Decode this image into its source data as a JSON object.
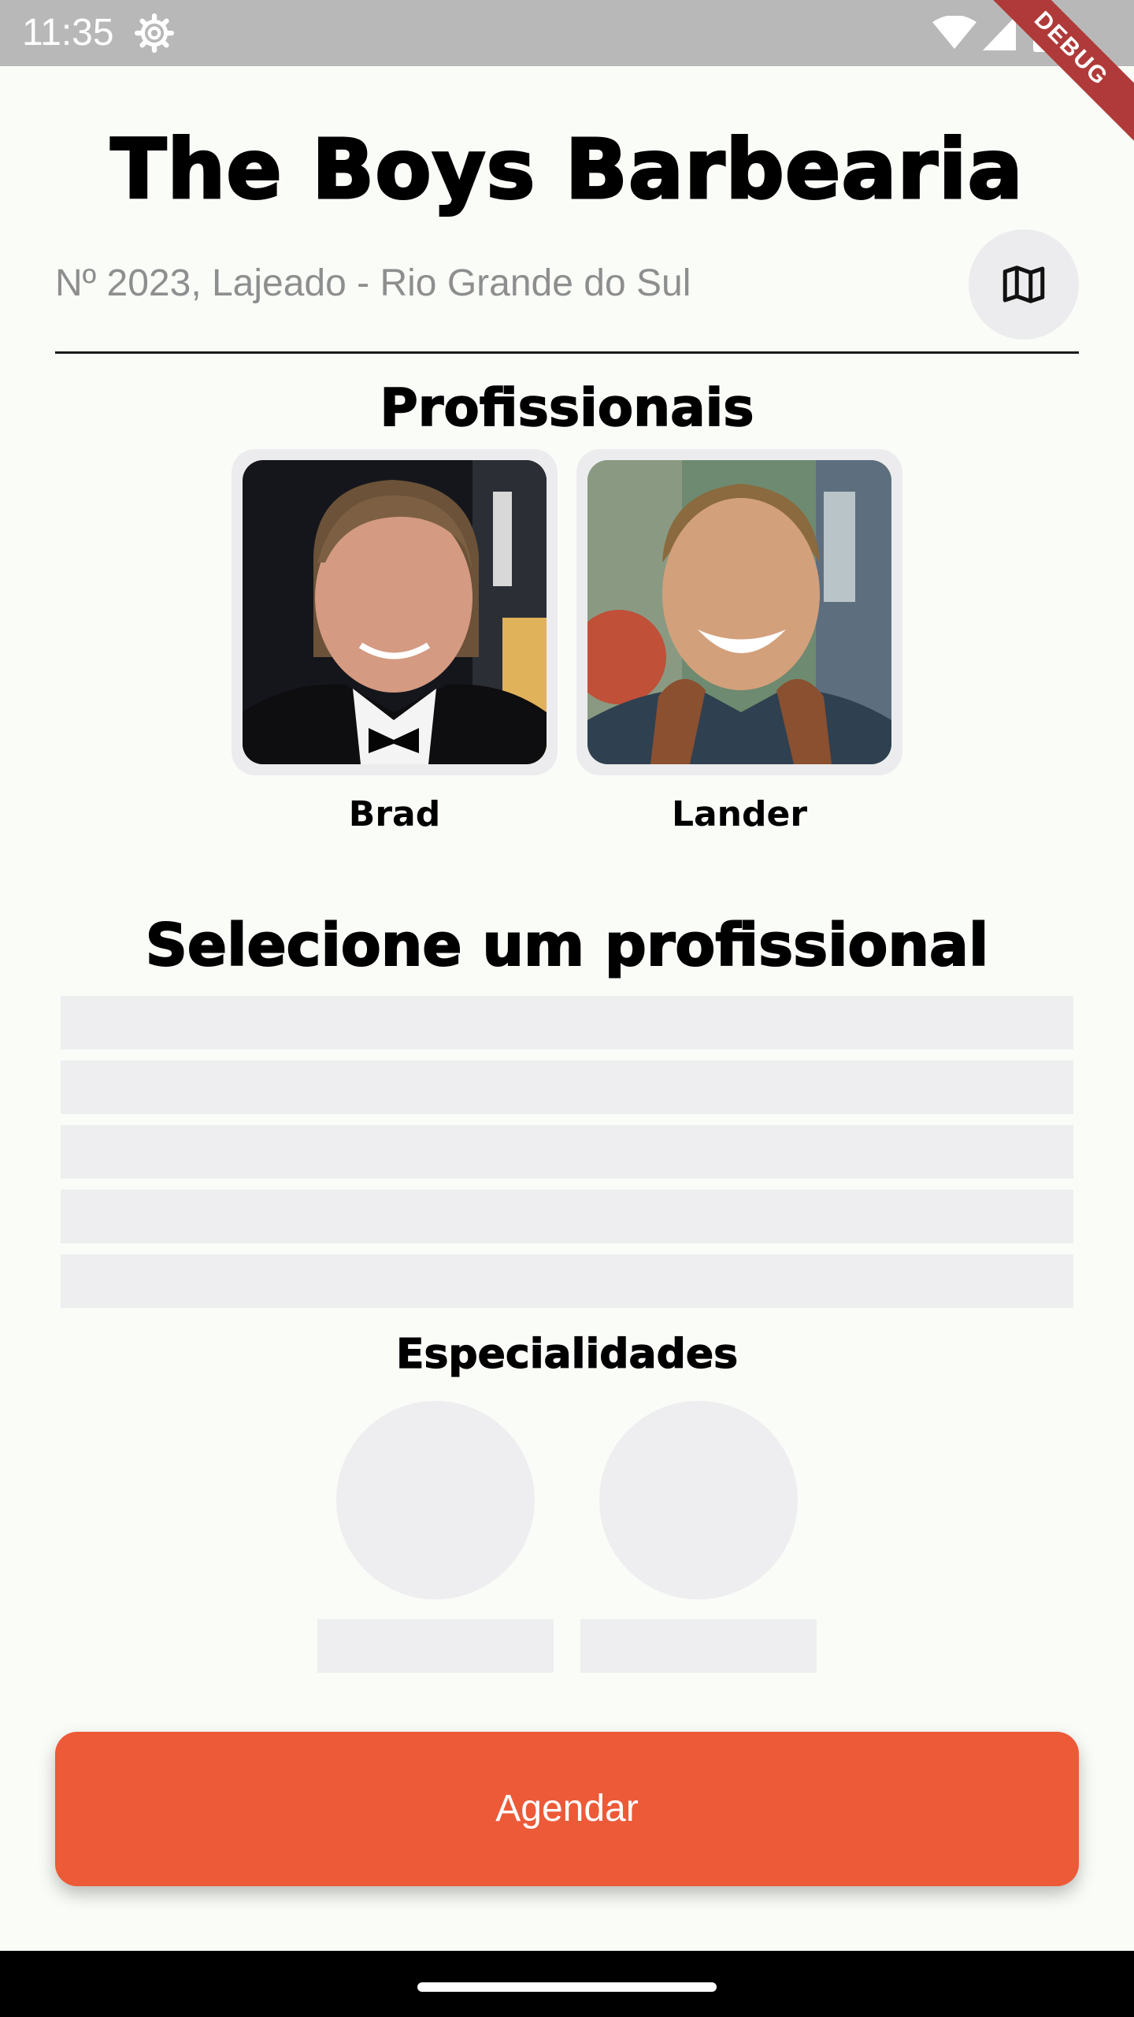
{
  "status_bar": {
    "time": "11:35",
    "icons": [
      "settings-gear-icon",
      "wifi-icon",
      "cell-signal-icon",
      "battery-icon"
    ]
  },
  "debug_banner": "DEBUG",
  "header": {
    "title": "The Boys Barbearia",
    "address": "Nº 2023, Lajeado - Rio Grande do Sul",
    "map_icon": "map-icon"
  },
  "professionals": {
    "heading": "Profissionais",
    "items": [
      {
        "name": "Brad"
      },
      {
        "name": "Lander"
      }
    ]
  },
  "schedule": {
    "heading": "Selecione um profissional",
    "placeholder_rows": 5
  },
  "specialties": {
    "heading": "Especialidades",
    "placeholder_items": 2
  },
  "actions": {
    "schedule_button": "Agendar"
  },
  "colors": {
    "accent": "#ec5a38",
    "skeleton": "#eeeef0",
    "background": "#fafcf8",
    "status_bar": "#b8b8b8"
  }
}
